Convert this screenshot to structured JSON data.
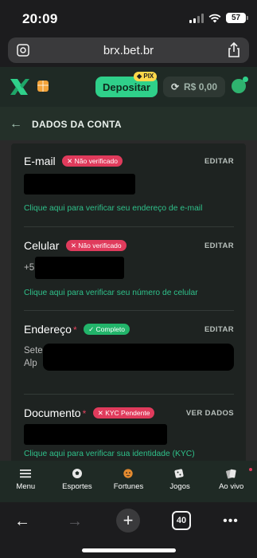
{
  "status_bar": {
    "time": "20:09",
    "battery": "57"
  },
  "browser": {
    "url": "brx.bet.br"
  },
  "header": {
    "deposit_label": "Depositar",
    "pix_label": "PIX",
    "balance": "R$ 0,00",
    "brand_color": "#2fd08a"
  },
  "page": {
    "title": "DADOS DA CONTA"
  },
  "sections": {
    "email": {
      "label": "E-mail",
      "badge": "✕ Não verificado",
      "action": "EDITAR",
      "hint": "Clique aqui para verificar seu endereço de e-mail"
    },
    "phone": {
      "label": "Celular",
      "badge": "✕ Não verificado",
      "action": "EDITAR",
      "value_prefix": "+5",
      "hint": "Clique aqui para verificar seu número de celular"
    },
    "address": {
      "label": "Endereço",
      "required": "*",
      "badge": "✓ Completo",
      "action": "EDITAR",
      "line1": "Sete",
      "line2": "Alp"
    },
    "document": {
      "label": "Documento",
      "required": "*",
      "badge": "✕ KYC Pendente",
      "action": "VER DADOS",
      "hint": "Clique aqui para verificar sua identidade (KYC)"
    }
  },
  "bottom_nav": [
    {
      "label": "Menu",
      "icon": "menu-icon"
    },
    {
      "label": "Esportes",
      "icon": "soccer-ball-icon"
    },
    {
      "label": "Fortunes",
      "icon": "tiger-icon"
    },
    {
      "label": "Jogos",
      "icon": "dice-icon"
    },
    {
      "label": "Ao vivo",
      "icon": "cards-icon"
    }
  ],
  "safari_toolbar": {
    "tabs_count": "40"
  }
}
